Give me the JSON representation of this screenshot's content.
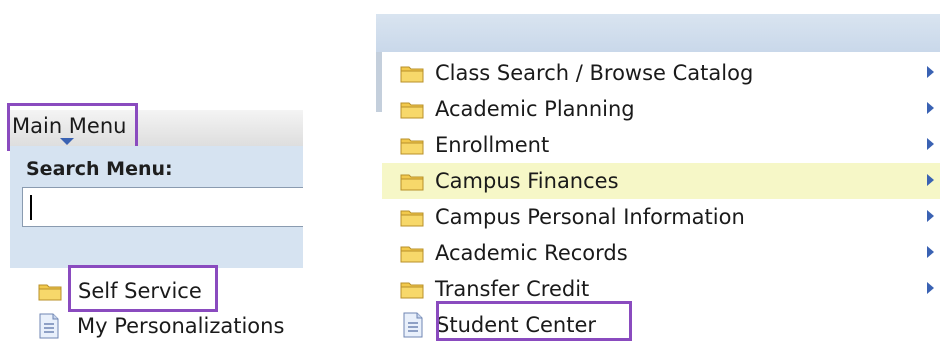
{
  "main_menu": {
    "label": "Main Menu",
    "search_label": "Search Menu:",
    "search_value": "",
    "items": [
      {
        "label": "Self Service",
        "icon": "folder-icon"
      },
      {
        "label": "My Personalizations",
        "icon": "document-icon"
      }
    ]
  },
  "submenu": {
    "items": [
      {
        "label": "Class Search / Browse Catalog",
        "icon": "folder-icon",
        "has_submenu": true
      },
      {
        "label": "Academic Planning",
        "icon": "folder-icon",
        "has_submenu": true
      },
      {
        "label": "Enrollment",
        "icon": "folder-icon",
        "has_submenu": true
      },
      {
        "label": "Campus Finances",
        "icon": "folder-icon",
        "has_submenu": true,
        "active": true
      },
      {
        "label": "Campus Personal Information",
        "icon": "folder-icon",
        "has_submenu": true
      },
      {
        "label": "Academic Records",
        "icon": "folder-icon",
        "has_submenu": true
      },
      {
        "label": "Transfer Credit",
        "icon": "folder-icon",
        "has_submenu": true
      },
      {
        "label": "Student Center",
        "icon": "document-icon",
        "has_submenu": false
      }
    ]
  },
  "colors": {
    "highlight_border": "#8a4bbf",
    "active_row": "#f6f7c7",
    "panel_blue": "#d6e3f1",
    "arrow_blue": "#3a62b3"
  }
}
